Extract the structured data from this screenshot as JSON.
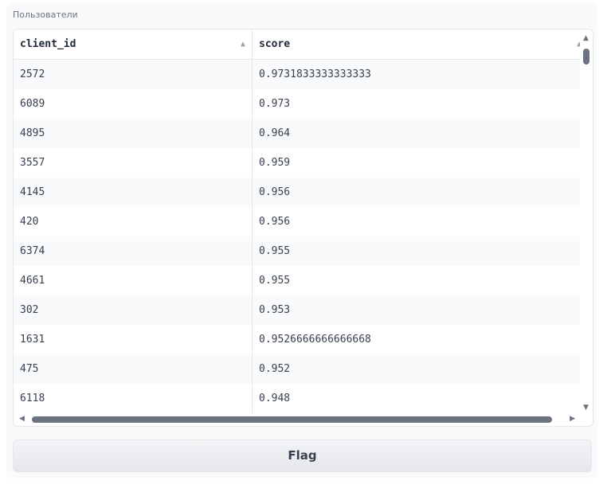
{
  "panel": {
    "label": "Пользователи"
  },
  "table": {
    "columns": [
      {
        "label": "client_id",
        "sort_icon": "sort-up-icon"
      },
      {
        "label": "score",
        "sort_icon": "sort-up-icon"
      }
    ],
    "rows": [
      [
        "2572",
        "0.9731833333333333"
      ],
      [
        "6089",
        "0.973"
      ],
      [
        "4895",
        "0.964"
      ],
      [
        "3557",
        "0.959"
      ],
      [
        "4145",
        "0.956"
      ],
      [
        "420",
        "0.956"
      ],
      [
        "6374",
        "0.955"
      ],
      [
        "4661",
        "0.955"
      ],
      [
        "302",
        "0.953"
      ],
      [
        "1631",
        "0.9526666666666668"
      ],
      [
        "475",
        "0.952"
      ],
      [
        "6118",
        "0.948"
      ]
    ]
  },
  "actions": {
    "flag_label": "Flag"
  },
  "colors": {
    "panel_bg": "#f9fafb",
    "border": "#e5e7eb",
    "scroll_thumb": "#6b7280"
  }
}
